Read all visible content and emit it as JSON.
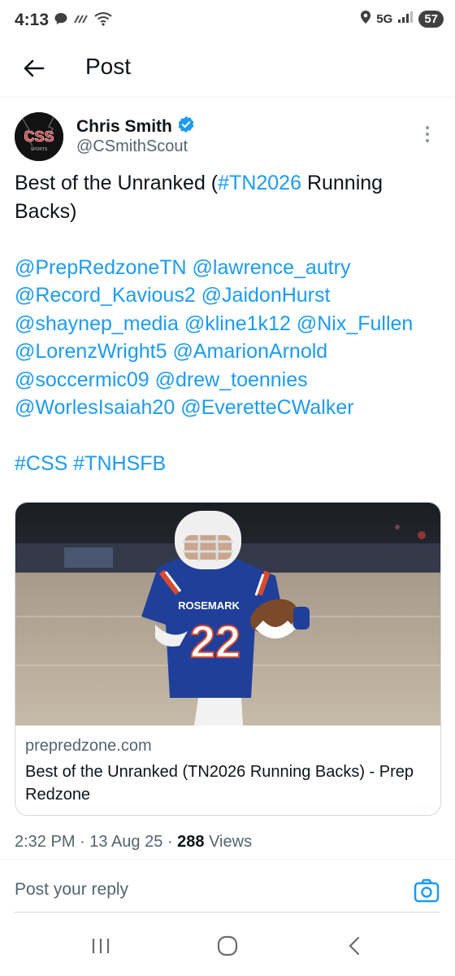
{
  "status_bar": {
    "time": "4:13",
    "network": "5G",
    "battery": "57"
  },
  "header": {
    "title": "Post"
  },
  "author": {
    "name": "Chris Smith",
    "handle": "@CSmithScout",
    "avatar_text": "CSS"
  },
  "post": {
    "line1_prefix": "Best of the Unranked (",
    "line1_hashtag": "#TN2026",
    "line1_suffix": " Running Backs)",
    "mentions": [
      [
        "@PrepRedzoneTN",
        "@lawrence_autry"
      ],
      [
        "@Record_Kavious2",
        "@JaidonHurst"
      ],
      [
        "@shaynep_media",
        "@kline1k12",
        "@Nix_Fullen"
      ],
      [
        "@LorenzWright5",
        "@AmarionArnold"
      ],
      [
        "@soccermic09",
        "@drew_toennies"
      ],
      [
        "@WorlesIsaiah20",
        "@EveretteCWalker"
      ]
    ],
    "hashtags": [
      "#CSS",
      "#TNHSFB"
    ]
  },
  "card": {
    "domain": "prepredzone.com",
    "title": "Best of the Unranked (TN2026 Running Backs) - Prep Redzone",
    "jersey_text": "ROSEMARK",
    "jersey_number": "22"
  },
  "meta": {
    "time": "2:32 PM",
    "date": "13 Aug 25",
    "views_count": "288",
    "views_label": "Views"
  },
  "reply": {
    "placeholder": "Post your reply"
  },
  "colors": {
    "link": "#1d9bf0",
    "text": "#0f1419",
    "secondary": "#536471"
  }
}
